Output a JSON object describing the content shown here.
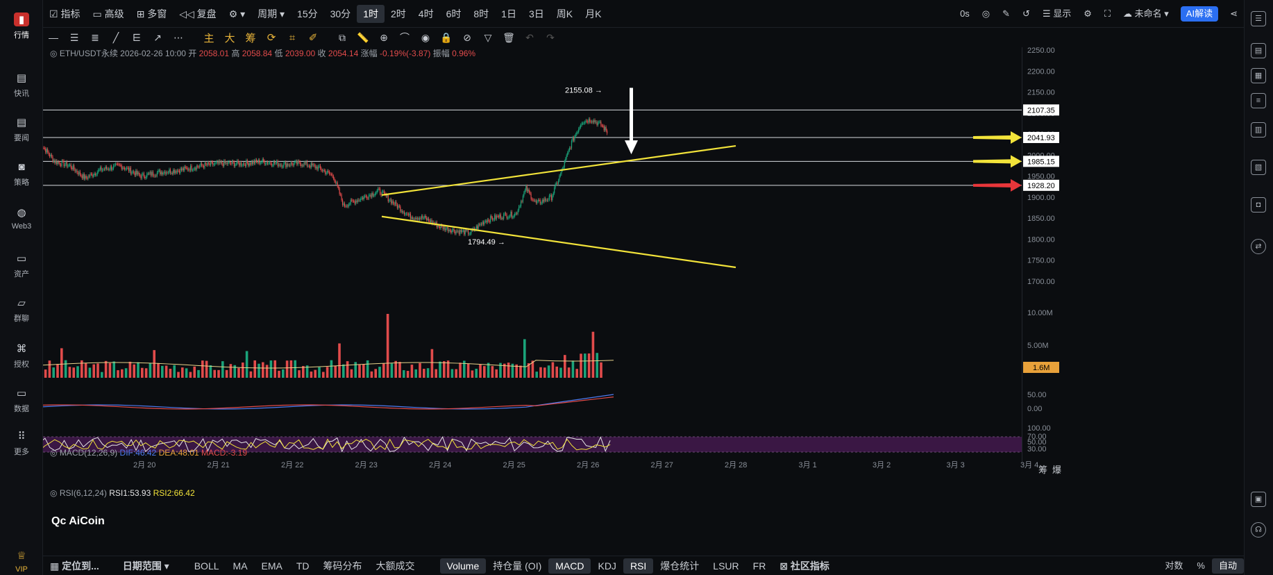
{
  "nav": [
    {
      "label": "行情",
      "icon": "bar-chart-icon"
    },
    {
      "label": "快讯",
      "icon": "news-flash-icon"
    },
    {
      "label": "要闻",
      "icon": "document-icon"
    },
    {
      "label": "策略",
      "icon": "robot-icon"
    },
    {
      "label": "Web3",
      "icon": "globe-icon"
    },
    {
      "label": "资产",
      "icon": "wallet-icon"
    },
    {
      "label": "群聊",
      "icon": "chat-icon"
    },
    {
      "label": "授权",
      "icon": "key-icon"
    },
    {
      "label": "数据",
      "icon": "monitor-icon"
    },
    {
      "label": "更多",
      "icon": "grid-icon"
    }
  ],
  "nav_vip": "VIP",
  "top": {
    "indicator": "指标",
    "advanced": "高级",
    "multi": "多窗",
    "replay": "复盘",
    "period": "周期",
    "intervals": [
      "15分",
      "30分",
      "1时",
      "2时",
      "4时",
      "6时",
      "8时",
      "1日",
      "3日",
      "周K",
      "月K"
    ],
    "selected_interval": "1时",
    "countdown": "0s",
    "display": "显示",
    "unnamed": "未命名",
    "ai": "AI解读"
  },
  "draw_tools": [
    "主",
    "大",
    "筹"
  ],
  "header": {
    "pair": "ETH/USDT永续",
    "time": "2026-02-26 10:00",
    "open_l": "开",
    "open": "2058.01",
    "high_l": "高",
    "high": "2058.84",
    "low_l": "低",
    "low": "2039.00",
    "close_l": "收",
    "close": "2054.14",
    "chg_l": "涨幅",
    "chg": "-0.19%(-3.87)",
    "amp_l": "振幅",
    "amp": "0.96%"
  },
  "price_axis": [
    "2250.00",
    "2200.00",
    "2150.00",
    "2100.00",
    "2050.00",
    "2000.00",
    "1950.00",
    "1900.00",
    "1850.00",
    "1800.00",
    "1750.00",
    "1700.00"
  ],
  "hlines": [
    {
      "price": "2107.35",
      "arrow": "none"
    },
    {
      "price": "2041.93",
      "arrow": "#f2e33a"
    },
    {
      "price": "1985.15",
      "arrow": "#f2e33a"
    },
    {
      "price": "1928.20",
      "arrow": "#e8363a"
    }
  ],
  "annotations": {
    "high": "2155.08 →",
    "low": "1794.49 →"
  },
  "volume_axis": [
    "10.00M",
    "5.00M"
  ],
  "volume_tag": "1.6M",
  "macd": {
    "label": "MACD(12,26,9)",
    "dif": "DIF:46.42",
    "dea": "DEA:48.01",
    "macd": "MACD:-3.19",
    "axis": [
      "50.00",
      "0.00"
    ]
  },
  "rsi": {
    "label": "RSI(6,12,24)",
    "rsi1": "RSI1:53.93",
    "rsi2": "RSI2:66.42",
    "axis": [
      "100.00",
      "70.00",
      "50.00",
      "30.00"
    ]
  },
  "x_axis": [
    "2月 20",
    "2月 21",
    "2月 22",
    "2月 23",
    "2月 24",
    "2月 25",
    "2月 26",
    "2月 27",
    "2月 28",
    "3月 1",
    "3月 2",
    "3月 3",
    "3月 4"
  ],
  "logo": "AiCoin",
  "chip": {
    "a": "筹",
    "b": "爆"
  },
  "bottom": {
    "locate": "定位到...",
    "range": "日期范围",
    "items": [
      "BOLL",
      "MA",
      "EMA",
      "TD",
      "筹码分布",
      "大额成交",
      "Volume",
      "持仓量 (OI)",
      "MACD",
      "KDJ",
      "RSI",
      "爆仓统计",
      "LSUR",
      "FR",
      "社区指标"
    ],
    "log": "对数",
    "pct": "%",
    "auto": "自动"
  },
  "colors": {
    "up": "#1aa37a",
    "down": "#e14b4b",
    "trend": "#f2e33a"
  }
}
